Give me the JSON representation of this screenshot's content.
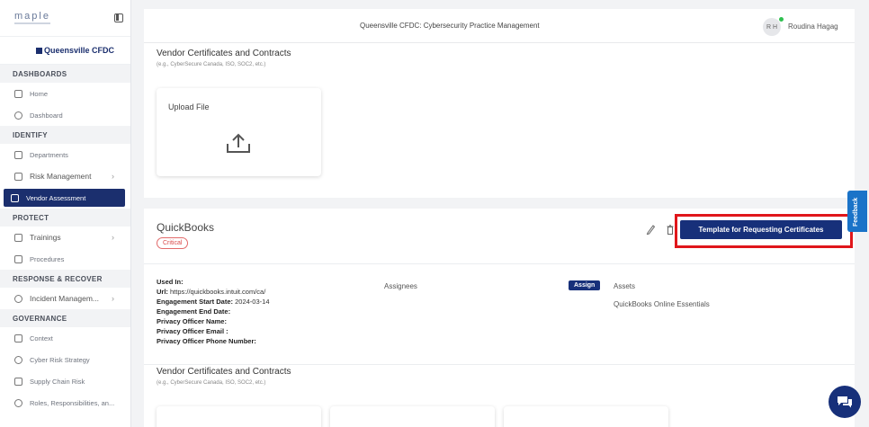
{
  "sidebar": {
    "logo_text": "maple",
    "org_name": "Queensville CFDC",
    "sections": [
      {
        "header": "DASHBOARDS",
        "items": [
          "Home",
          "Dashboard"
        ]
      },
      {
        "header": "IDENTIFY",
        "items": [
          "Departments",
          "Risk Management",
          "Vendor Assessment"
        ]
      },
      {
        "header": "PROTECT",
        "items": [
          "Trainings",
          "Procedures"
        ]
      },
      {
        "header": "RESPONSE & RECOVER",
        "items": [
          "Incident Managem..."
        ]
      },
      {
        "header": "GOVERNANCE",
        "items": [
          "Context",
          "Cyber Risk Strategy",
          "Supply Chain Risk",
          "Roles, Responsibilities, an..."
        ]
      }
    ]
  },
  "header": {
    "title": "Queensville CFDC: Cybersecurity Practice Management",
    "user_initials": "R H",
    "user_name": "Roudina Hagag"
  },
  "certificates_section": {
    "title": "Vendor Certificates and Contracts",
    "subtitle": "(e.g., CyberSecure Canada, ISO, SOC2, etc.)",
    "upload_label": "Upload File"
  },
  "vendor": {
    "name": "QuickBooks",
    "criticality": "Critical",
    "template_button": "Template for Requesting Certificates",
    "used_in_label": "Used In:",
    "url_label": "Url:",
    "url_value": "https://quickbooks.intuit.com/ca/",
    "start_label": "Engagement Start Date:",
    "start_value": "2024-03-14",
    "end_label": "Engagement End Date:",
    "privacy_name_label": "Privacy Officer Name:",
    "privacy_email_label": "Privacy Officer Email :",
    "privacy_phone_label": "Privacy Officer Phone Number:",
    "assignees_label": "Assignees",
    "assign_button": "Assign",
    "assets_label": "Assets",
    "asset_value": "QuickBooks Online Essentials",
    "certificates_title": "Vendor Certificates and Contracts",
    "certificates_subtitle": "(e.g., CyberSecure Canada, ISO, SOC2, etc.)"
  },
  "feedback_label": "Feedback",
  "colors": {
    "brand": "#17307a",
    "highlight": "#e0161b",
    "critical": "#d94a4a",
    "feedback": "#1a73c8"
  },
  "icons": [
    "home-icon",
    "dashboard-icon",
    "departments-icon",
    "risk-icon",
    "vendor-icon",
    "trainings-icon",
    "procedures-icon",
    "incident-icon",
    "context-icon",
    "strategy-icon",
    "supply-chain-icon",
    "roles-icon",
    "upload-icon",
    "edit-icon",
    "trash-icon",
    "chat-icon"
  ]
}
